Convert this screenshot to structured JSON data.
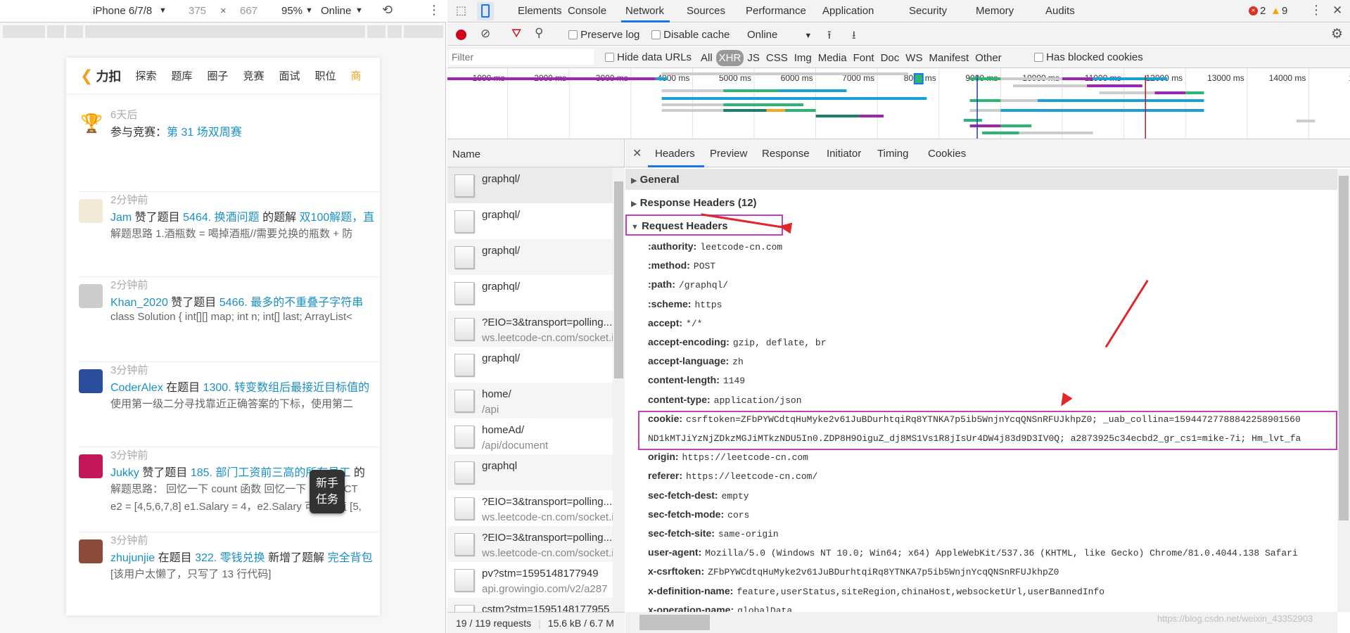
{
  "device_toolbar": {
    "device": "iPhone 6/7/8",
    "width": "375",
    "times": "×",
    "height": "667",
    "zoom": "95%",
    "throttle": "Online"
  },
  "phone": {
    "logo": "力扣",
    "nav": [
      "探索",
      "题库",
      "圈子",
      "竞赛",
      "面试",
      "职位"
    ],
    "nav_more": "商",
    "feed": [
      {
        "time": "6天后",
        "pre": "参与竞赛：",
        "user": "",
        "action": "",
        "link": "第 31 场双周赛",
        "tail": "",
        "l2": "",
        "l3": ""
      },
      {
        "time": "2分钟前",
        "user": "Jam",
        "action": " 赞了题目 ",
        "link": "5464. 换酒问题",
        "tail": " 的题解 ",
        "link2": "双100解题，直",
        "l2": "解题思路 1.酒瓶数 = 喝掉酒瓶//需要兑换的瓶数 + 防",
        "l3": ""
      },
      {
        "time": "2分钟前",
        "user": "Khan_2020",
        "action": " 赞了题目 ",
        "link": "5466. 最多的不重叠子字符串",
        "tail": "",
        "l2": "class Solution { int[][] map; int n; int[] last; ArrayList<",
        "l3": ""
      },
      {
        "time": "3分钟前",
        "user": "CoderAlex",
        "action": " 在题目 ",
        "link": "1300. 转变数组后最接近目标值的",
        "tail": "",
        "l2": "使用第一级二分寻找靠近正确答案的下标，使用第二",
        "l3": ""
      },
      {
        "time": "3分钟前",
        "user": "Jukky",
        "action": " 赞了题目 ",
        "link": "185. 部门工资前三高的所有员工",
        "tail": " 的",
        "l2": "解题思路：  回忆一下 count 函数 回忆一下 DISTINCT",
        "l3": "e2 = [4,5,6,7,8] e1.Salary = 4，e2.Salary 可以取值 [5,"
      },
      {
        "time": "3分钟前",
        "user": "zhujunjie",
        "action": " 在题目 ",
        "link": "322. 零钱兑换",
        "tail": " 新增了题解 ",
        "link2": "完全背包",
        "l2": "[该用户太懒了，只写了 13 行代码]",
        "l3": ""
      }
    ],
    "task_button": [
      "新手",
      "任务"
    ]
  },
  "devtools": {
    "tabs": [
      "Elements",
      "Console",
      "Network",
      "Sources",
      "Performance",
      "Application",
      "Security",
      "Memory",
      "Audits"
    ],
    "active_tab": "Network",
    "errors": "2",
    "warnings": "9",
    "toolbar": {
      "preserve_log": "Preserve log",
      "disable_cache": "Disable cache",
      "throttle": "Online"
    },
    "filter": {
      "placeholder": "Filter",
      "hide_data_urls": "Hide data URLs",
      "types": [
        "All",
        "XHR",
        "JS",
        "CSS",
        "Img",
        "Media",
        "Font",
        "Doc",
        "WS",
        "Manifest",
        "Other"
      ],
      "active_type": "XHR",
      "blocked": "Has blocked cookies"
    },
    "overview_ticks": [
      "1000 ms",
      "2000 ms",
      "3000 ms",
      "4000 ms",
      "5000 ms",
      "6000 ms",
      "7000 ms",
      "8000 ms",
      "9000 ms",
      "10000 ms",
      "11000 ms",
      "12000 ms",
      "13000 ms",
      "14000 ms",
      "1500"
    ],
    "name_header": "Name",
    "requests": [
      {
        "name": "graphql/",
        "sub": ""
      },
      {
        "name": "graphql/",
        "sub": ""
      },
      {
        "name": "graphql/",
        "sub": ""
      },
      {
        "name": "graphql/",
        "sub": ""
      },
      {
        "name": "?EIO=3&transport=polling...",
        "sub": "ws.leetcode-cn.com/socket.io"
      },
      {
        "name": "graphql/",
        "sub": ""
      },
      {
        "name": "home/",
        "sub": "/api"
      },
      {
        "name": "homeAd/",
        "sub": "/api/document"
      },
      {
        "name": "graphql",
        "sub": ""
      },
      {
        "name": "?EIO=3&transport=polling...",
        "sub": "ws.leetcode-cn.com/socket.io"
      },
      {
        "name": "?EIO=3&transport=polling...",
        "sub": "ws.leetcode-cn.com/socket.io"
      },
      {
        "name": "pv?stm=1595148177949",
        "sub": "api.growingio.com/v2/a287"
      },
      {
        "name": "cstm?stm=1595148177955",
        "sub": ""
      }
    ],
    "status": {
      "requests": "19 / 119 requests",
      "size": "15.6 kB / 6.7 M"
    },
    "detail_tabs": [
      "Headers",
      "Preview",
      "Response",
      "Initiator",
      "Timing",
      "Cookies"
    ],
    "active_detail_tab": "Headers",
    "sections": {
      "general": "General",
      "response": "Response Headers (12)",
      "request": "Request Headers"
    },
    "request_headers": [
      {
        "k": ":authority:",
        "v": "leetcode-cn.com"
      },
      {
        "k": ":method:",
        "v": "POST"
      },
      {
        "k": ":path:",
        "v": "/graphql/"
      },
      {
        "k": ":scheme:",
        "v": "https"
      },
      {
        "k": "accept:",
        "v": "*/*"
      },
      {
        "k": "accept-encoding:",
        "v": "gzip, deflate, br"
      },
      {
        "k": "accept-language:",
        "v": "zh"
      },
      {
        "k": "content-length:",
        "v": "1149"
      },
      {
        "k": "content-type:",
        "v": "application/json"
      },
      {
        "k": "cookie:",
        "v": "csrftoken=ZFbPYWCdtqHuMyke2v61JuBDurhtqiRq8YTNKA7p5ib5WnjnYcqQNSnRFUJkhpZ0; _uab_collina=15944727788842258901560"
      },
      {
        "k": "",
        "v": "ND1kMTJiYzNjZDkzMGJiMTkzNDU5In0.ZDP8H9OiguZ_dj8MS1Vs1R8jIsUr4DW4j83d9D3IV0Q; a2873925c34ecbd2_gr_cs1=mike-7i; Hm_lvt_fa"
      },
      {
        "k": "origin:",
        "v": "https://leetcode-cn.com"
      },
      {
        "k": "referer:",
        "v": "https://leetcode-cn.com/"
      },
      {
        "k": "sec-fetch-dest:",
        "v": "empty"
      },
      {
        "k": "sec-fetch-mode:",
        "v": "cors"
      },
      {
        "k": "sec-fetch-site:",
        "v": "same-origin"
      },
      {
        "k": "user-agent:",
        "v": "Mozilla/5.0 (Windows NT 10.0; Win64; x64) AppleWebKit/537.36 (KHTML, like Gecko) Chrome/81.0.4044.138 Safari"
      },
      {
        "k": "x-csrftoken:",
        "v": "ZFbPYWCdtqHuMyke2v61JuBDurhtqiRq8YTNKA7p5ib5WnjnYcqQNSnRFUJkhpZ0"
      },
      {
        "k": "x-definition-name:",
        "v": "feature,userStatus,siteRegion,chinaHost,websocketUrl,userBannedInfo"
      },
      {
        "k": "x-operation-name:",
        "v": "globalData"
      }
    ],
    "watermark": "https://blog.csdn.net/weixin_43352903"
  },
  "colors": {
    "accent": "#1a73e8",
    "link": "#1a90c6",
    "highlight_box": "#c040c0",
    "annotation_arrow": "#e3262a",
    "record": "#d0021b"
  }
}
